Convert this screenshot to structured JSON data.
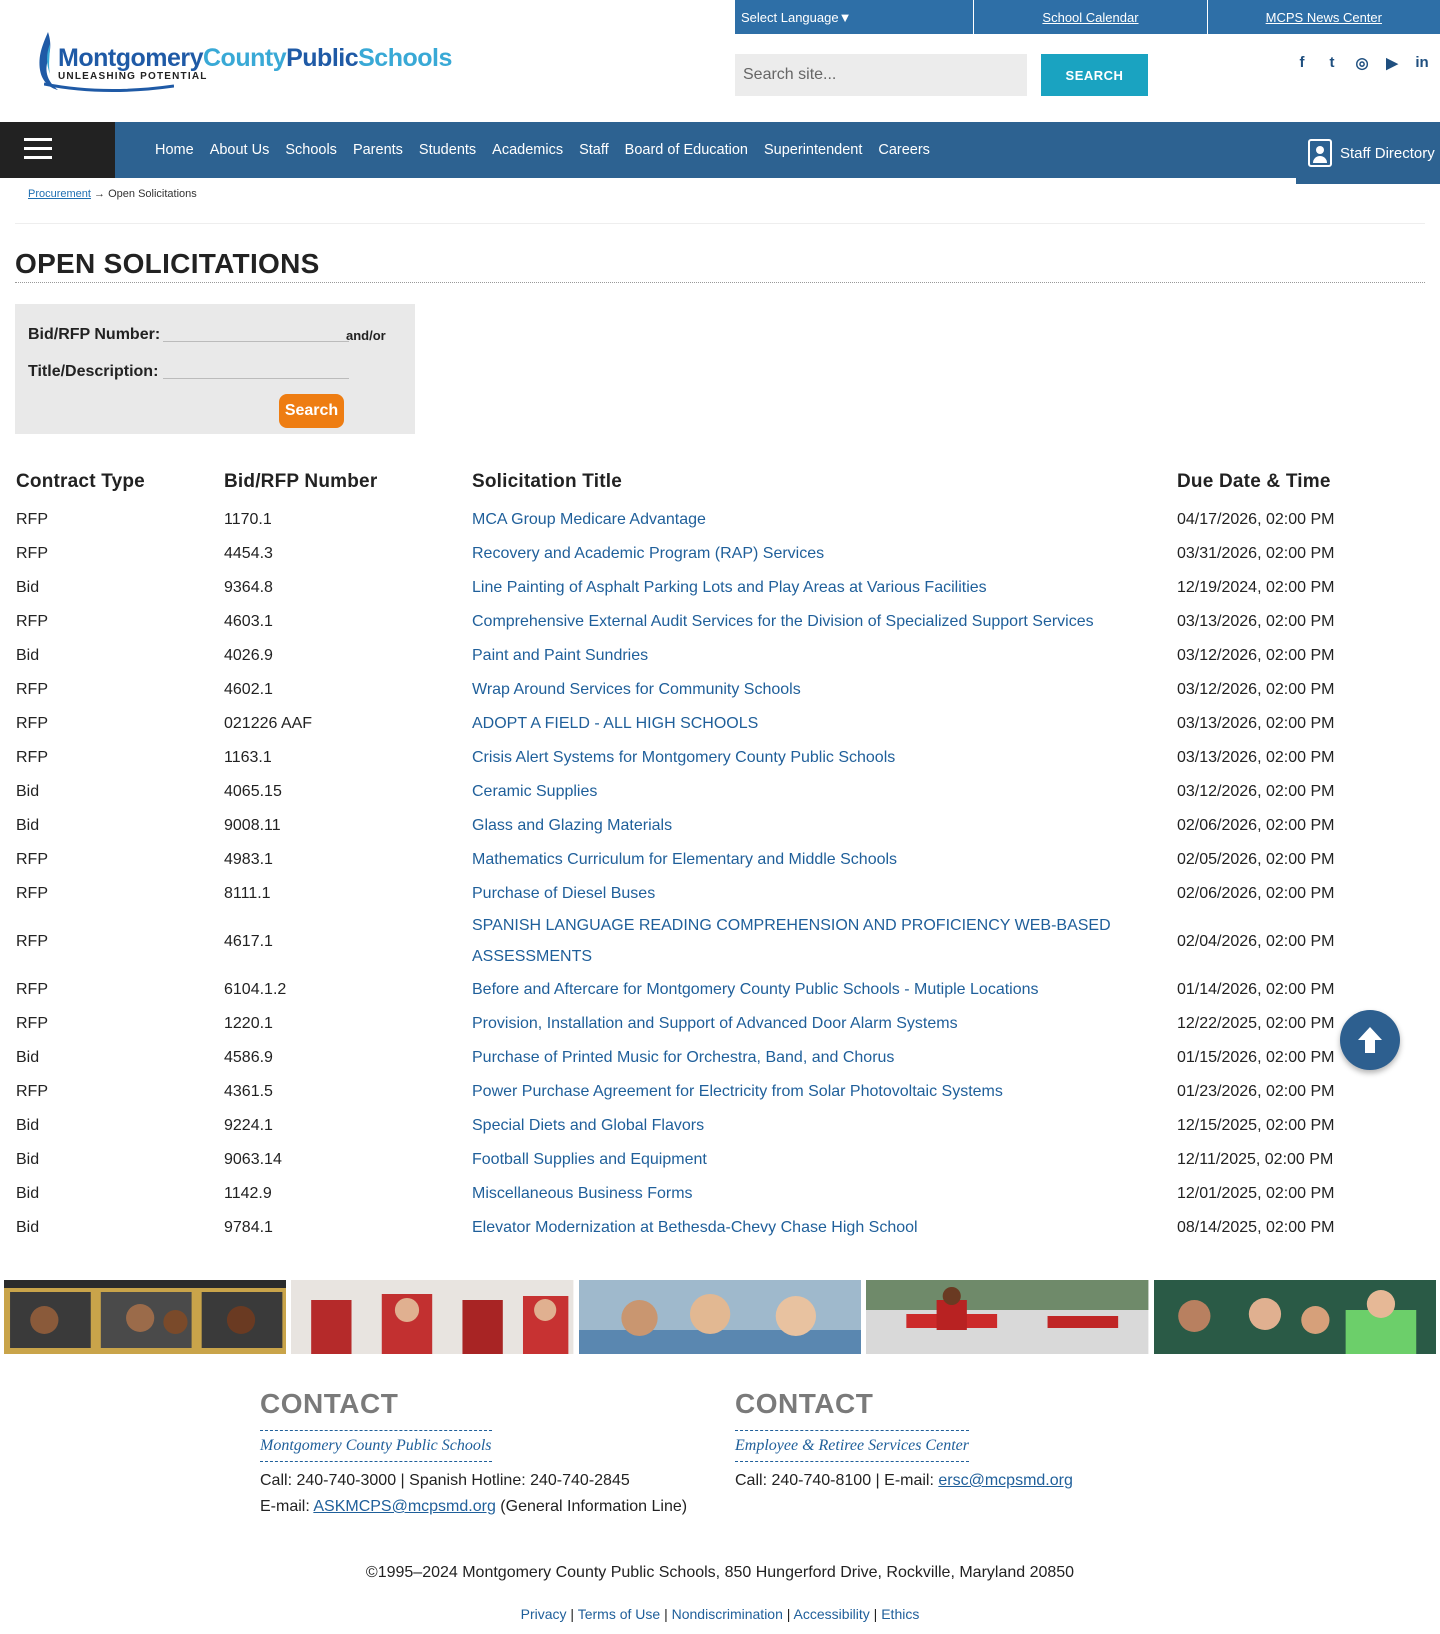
{
  "header": {
    "logo_title_1": "Montgomery",
    "logo_title_2": "County",
    "logo_title_3": "Public",
    "logo_title_4": "Schools",
    "logo_tagline": "UNLEASHING POTENTIAL",
    "top_links": [
      "Select Language▼",
      "School Calendar",
      "MCPS News Center"
    ],
    "search_placeholder": "Search site...",
    "search_label": "SEARCH",
    "social_icons": [
      "facebook-icon",
      "twitter-icon",
      "instagram-icon",
      "youtube-icon",
      "linkedin-icon"
    ],
    "social_glyphs": [
      "f",
      "t",
      "◎",
      "▶",
      "in"
    ]
  },
  "nav": {
    "items": [
      "Home",
      "About Us",
      "Schools",
      "Parents",
      "Students",
      "Academics",
      "Staff",
      "Board of Education",
      "Superintendent",
      "Careers"
    ],
    "staff_directory": "Staff Directory"
  },
  "breadcrumb": {
    "parent": "Procurement",
    "separator": "→",
    "current": "Open Solicitations"
  },
  "page_title": "OPEN SOLICITATIONS",
  "filter": {
    "bid_label": "Bid/RFP Number:",
    "andor": "and/or",
    "title_label": "Title/Description:",
    "button": "Search"
  },
  "table": {
    "headers": [
      "Contract Type",
      "Bid/RFP Number",
      "Solicitation Title",
      "Due Date & Time"
    ],
    "rows": [
      [
        "RFP",
        "1170.1",
        "MCA Group Medicare Advantage",
        "04/17/2026, 02:00 PM"
      ],
      [
        "RFP",
        "4454.3",
        "Recovery and Academic Program (RAP) Services",
        "03/31/2026, 02:00 PM"
      ],
      [
        "Bid",
        "9364.8",
        "Line Painting of Asphalt Parking Lots and Play Areas at Various Facilities",
        "12/19/2024, 02:00 PM"
      ],
      [
        "RFP",
        "4603.1",
        "Comprehensive External Audit Services for the Division of Specialized Support Services",
        "03/13/2026, 02:00 PM"
      ],
      [
        "Bid",
        "4026.9",
        "Paint and Paint Sundries",
        "03/12/2026, 02:00 PM"
      ],
      [
        "RFP",
        "4602.1",
        "Wrap Around Services for Community Schools",
        "03/12/2026, 02:00 PM"
      ],
      [
        "RFP",
        "021226 AAF",
        "ADOPT A FIELD - ALL HIGH SCHOOLS",
        "03/13/2026, 02:00 PM"
      ],
      [
        "RFP",
        "1163.1",
        "Crisis Alert Systems for Montgomery County Public Schools",
        "03/13/2026, 02:00 PM"
      ],
      [
        "Bid",
        "4065.15",
        "Ceramic Supplies",
        "03/12/2026, 02:00 PM"
      ],
      [
        "Bid",
        "9008.11",
        "Glass and Glazing Materials",
        "02/06/2026, 02:00 PM"
      ],
      [
        "RFP",
        "4983.1",
        "Mathematics Curriculum for Elementary and Middle Schools",
        "02/05/2026, 02:00 PM"
      ],
      [
        "RFP",
        "8111.1",
        "Purchase of Diesel Buses",
        "02/06/2026, 02:00 PM"
      ],
      [
        "RFP",
        "4617.1",
        "SPANISH LANGUAGE READING COMPREHENSION AND PROFICIENCY WEB-BASED ASSESSMENTS",
        "02/04/2026, 02:00 PM"
      ],
      [
        "RFP",
        "6104.1.2",
        "Before and Aftercare for Montgomery County Public Schools - Mutiple Locations",
        "01/14/2026, 02:00 PM"
      ],
      [
        "RFP",
        "1220.1",
        "Provision, Installation and Support of Advanced Door Alarm Systems",
        "12/22/2025, 02:00 PM"
      ],
      [
        "Bid",
        "4586.9",
        "Purchase of Printed Music for Orchestra, Band, and Chorus",
        "01/15/2026, 02:00 PM"
      ],
      [
        "RFP",
        "4361.5",
        "Power Purchase Agreement for Electricity from Solar Photovoltaic Systems",
        "01/23/2026, 02:00 PM"
      ],
      [
        "Bid",
        "9224.1",
        "Special Diets and Global Flavors",
        "12/15/2025, 02:00 PM"
      ],
      [
        "Bid",
        "9063.14",
        "Football Supplies and Equipment",
        "12/11/2025, 02:00 PM"
      ],
      [
        "Bid",
        "1142.9",
        "Miscellaneous Business Forms",
        "12/01/2025, 02:00 PM"
      ],
      [
        "Bid",
        "9784.1",
        "Elevator Modernization at Bethesda-Chevy Chase High School",
        "08/14/2025, 02:00 PM"
      ]
    ]
  },
  "footer": {
    "contact1": {
      "title": "CONTACT",
      "org": "Montgomery County Public Schools",
      "line1": "Call: 240-740-3000 | Spanish Hotline: 240-740-2845",
      "email_prefix": "E-mail: ",
      "email": "ASKMCPS@mcpsmd.org",
      "email_suffix": " (General Information Line)"
    },
    "contact2": {
      "title": "CONTACT",
      "org": "Employee & Retiree Services Center",
      "line1_prefix": "Call: 240-740-8100 | E-mail: ",
      "email": "ersc@mcpsmd.org"
    },
    "copyright": "©1995–2024 Montgomery County Public Schools, 850 Hungerford Drive, Rockville, Maryland 20850",
    "links": [
      "Privacy",
      "Terms of Use",
      "Nondiscrimination",
      "Accessibility",
      "Ethics"
    ]
  },
  "colors": {
    "nav_blue": "#2d6291",
    "link_blue": "#1f5f9a",
    "search_teal": "#1aa3c1",
    "button_orange": "#ee7d12"
  }
}
